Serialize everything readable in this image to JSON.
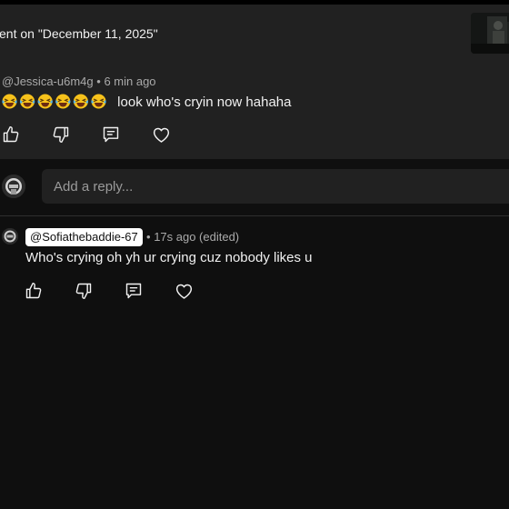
{
  "header": {
    "title": "ent on \"December 11, 2025\"",
    "thumbnail_icon": "video-thumbnail"
  },
  "comment": {
    "author": "@Jessica-u6m4g",
    "separator": "•",
    "time": "6 min ago",
    "emoji": [
      "😂",
      "😂",
      "😂",
      "😂",
      "😂",
      "😂"
    ],
    "text": "look who's cryin now hahaha",
    "actions": [
      "like-icon",
      "dislike-icon",
      "reply-icon",
      "heart-icon"
    ]
  },
  "reply_box": {
    "placeholder": "Add a reply..."
  },
  "reply": {
    "mention": "@Sofiathebaddie-67",
    "separator": "•",
    "time": "17s ago (edited)",
    "text": "Who's crying oh yh ur crying cuz nobody likes u",
    "actions": [
      "like-icon",
      "dislike-icon",
      "reply-icon",
      "heart-icon"
    ]
  },
  "colors": {
    "background": "#0f0f0f",
    "card": "#212121",
    "text": "#f1f1f1",
    "muted": "#aaaaaa",
    "mention_bg": "#ffffff"
  }
}
